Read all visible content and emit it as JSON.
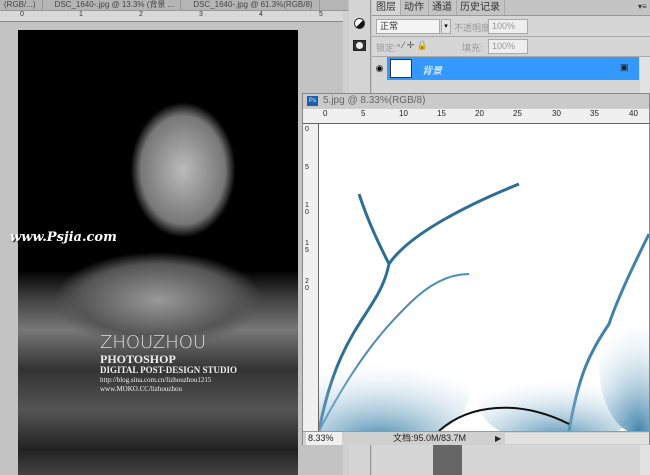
{
  "doc_tabs": [
    "(RGB/...)",
    "DSC_1640-.jpg @ 13.3% (背景 ...",
    "DSC_1640-.jpg @ 61.3%(RGB/8)"
  ],
  "left_ruler": [
    "0",
    "1",
    "2",
    "3",
    "4",
    "5"
  ],
  "photo": {
    "watermark": "www.Psjia.com",
    "title": "ZHOUZHOU",
    "subtitle": "PHOTOSHOP",
    "studio": "DIGITAL POST-DESIGN STUDIO",
    "url1": "http://blog.sina.com.cn/lizhouzhou1215",
    "url2": "www.MOKO.CC/lizhouzhou"
  },
  "layers_panel": {
    "tabs": [
      "图层",
      "动作",
      "通道",
      "历史记录"
    ],
    "blend_mode": "正常",
    "opacity_label": "不透明度:",
    "opacity": "100%",
    "lock_label": "锁定:",
    "fill_label": "填充:",
    "fill": "100%",
    "layer_name": "背景"
  },
  "document": {
    "title": "5.jpg @ 8.33%(RGB/8)",
    "ruler": [
      "0",
      "5",
      "10",
      "15",
      "20",
      "25",
      "30",
      "35",
      "40"
    ],
    "vruler": [
      "0",
      "5",
      "1\n0",
      "1\n5",
      "2\n0"
    ],
    "zoom": "8.33%",
    "doc_size": "文档:95.0M/83.7M"
  },
  "colors": {
    "selection": "#3399ff",
    "workspace": "#c3c3c3"
  }
}
